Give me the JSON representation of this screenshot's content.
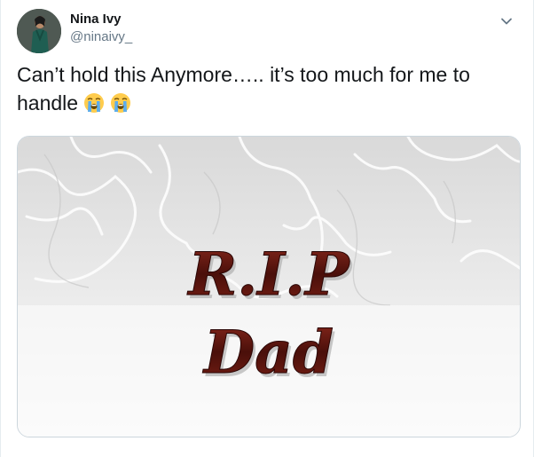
{
  "user": {
    "display_name": "Nina Ivy",
    "handle": "@ninaivy_"
  },
  "tweet": {
    "text": "Can’t hold this Anymore….. it’s too much for me to handle",
    "emoji": [
      "loudly-crying-face",
      "loudly-crying-face"
    ]
  },
  "media": {
    "line1": "R.I.P",
    "line2": "Dad"
  },
  "colors": {
    "name": "#14171a",
    "handle": "#657786",
    "border": "#ccd6dd",
    "rip_text": "#5a1510"
  }
}
